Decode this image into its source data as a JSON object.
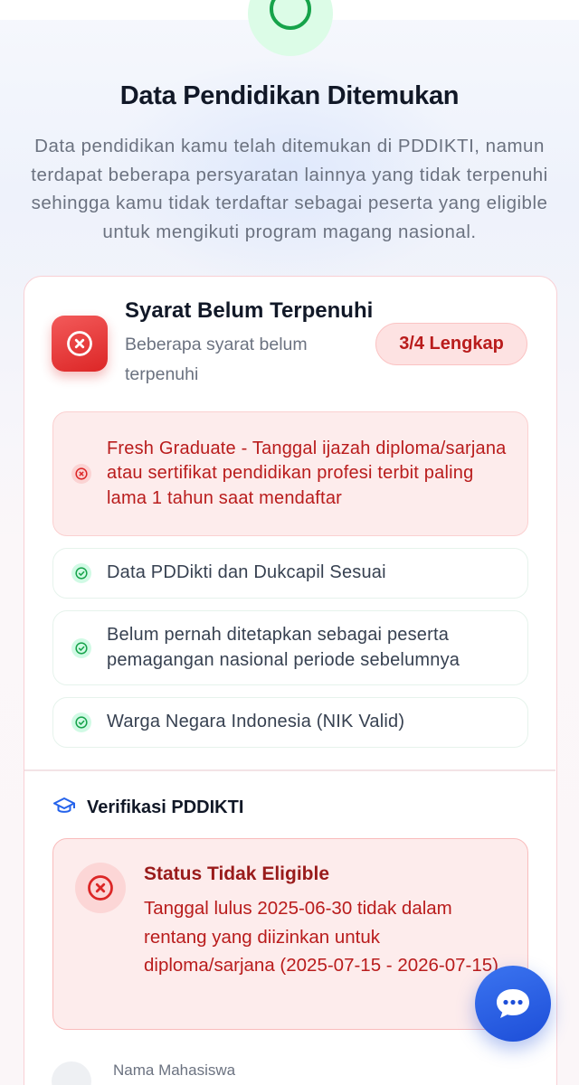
{
  "header": {
    "title": "Data Pendidikan Ditemukan",
    "description": "Data pendidikan kamu telah ditemukan di PDDIKTI, namun terdapat beberapa persyaratan lainnya yang tidak terpenuhi sehingga kamu tidak terdaftar sebagai peserta yang eligible untuk mengikuti program magang nasional."
  },
  "requirements": {
    "title": "Syarat Belum Terpenuhi",
    "subtitle": "Beberapa syarat belum terpenuhi",
    "badge": "3/4 Lengkap",
    "items": [
      {
        "status": "fail",
        "text": "Fresh Graduate - Tanggal ijazah diploma/sarjana atau sertifikat pendidikan profesi terbit paling lama 1 tahun saat mendaftar"
      },
      {
        "status": "ok",
        "text": "Data PDDikti dan Dukcapil Sesuai"
      },
      {
        "status": "ok",
        "text": "Belum pernah ditetapkan sebagai peserta pemagangan nasional periode sebelumnya"
      },
      {
        "status": "ok",
        "text": "Warga Negara Indonesia (NIK Valid)"
      }
    ]
  },
  "verification": {
    "title": "Verifikasi PDDIKTI",
    "status_title": "Status Tidak Eligible",
    "status_text": "Tanggal lulus 2025-06-30 tidak dalam rentang yang diizinkan untuk diploma/sarjana (2025-07-15 - 2026-07-15)",
    "next_label": "Nama Mahasiswa"
  },
  "icons": {
    "success": "check-circle-icon",
    "fail": "x-circle-icon",
    "ok": "check-circle-icon",
    "education": "graduation-cap-icon",
    "chat": "chat-bubble-icon"
  },
  "colors": {
    "danger": "#dc2626",
    "danger_text": "#b91c1c",
    "success": "#16a34a",
    "chat_accent": "#1d4ed8"
  }
}
